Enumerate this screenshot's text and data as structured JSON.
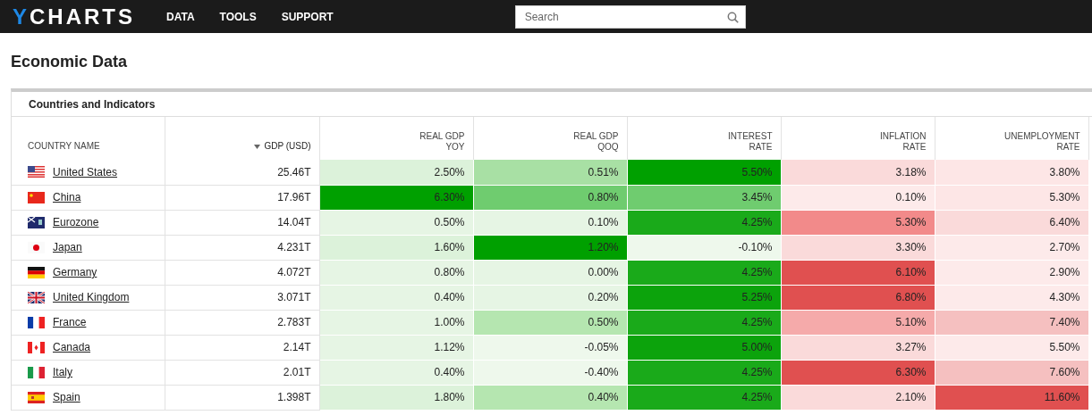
{
  "nav": {
    "logo": "YCHARTS",
    "items": [
      "DATA",
      "TOOLS",
      "SUPPORT"
    ],
    "search": {
      "placeholder": "Search"
    }
  },
  "page_title": "Economic Data",
  "panel": {
    "title": "Countries and Indicators",
    "columns": [
      {
        "label": "COUNTRY NAME",
        "sorted": false
      },
      {
        "label": "GDP (USD)",
        "sorted": true
      },
      {
        "label": "REAL GDP\nYOY",
        "sorted": false
      },
      {
        "label": "REAL GDP\nQOQ",
        "sorted": false
      },
      {
        "label": "INTEREST\nRATE",
        "sorted": false
      },
      {
        "label": "INFLATION\nRATE",
        "sorted": false
      },
      {
        "label": "UNEMPLOYMENT\nRATE",
        "sorted": false
      }
    ],
    "rows": [
      {
        "kind": "us",
        "cells": [
          {
            "text": "United States"
          },
          {
            "text": "25.46T"
          },
          {
            "text": "2.50%",
            "color": "#dcf2da"
          },
          {
            "text": "0.51%",
            "color": "#a8e0a4"
          },
          {
            "text": "5.50%",
            "color": "#00a000"
          },
          {
            "text": "3.18%",
            "color": "#fadada"
          },
          {
            "text": "3.80%",
            "color": "#fde6e6"
          }
        ]
      },
      {
        "kind": "cn",
        "cells": [
          {
            "text": "China"
          },
          {
            "text": "17.96T"
          },
          {
            "text": "6.30%",
            "color": "#00a000"
          },
          {
            "text": "0.80%",
            "color": "#6fcc6f"
          },
          {
            "text": "3.45%",
            "color": "#6fcc6f"
          },
          {
            "text": "0.10%",
            "color": "#fdeaea"
          },
          {
            "text": "5.30%",
            "color": "#fde6e6"
          }
        ]
      },
      {
        "kind": "eu",
        "cells": [
          {
            "text": "Eurozone"
          },
          {
            "text": "14.04T"
          },
          {
            "text": "0.50%",
            "color": "#e6f5e4"
          },
          {
            "text": "0.10%",
            "color": "#e6f5e4"
          },
          {
            "text": "4.25%",
            "color": "#1aaa1a"
          },
          {
            "text": "5.30%",
            "color": "#f28a8a"
          },
          {
            "text": "6.40%",
            "color": "#fadada"
          }
        ]
      },
      {
        "kind": "jp",
        "cells": [
          {
            "text": "Japan"
          },
          {
            "text": "4.231T"
          },
          {
            "text": "1.60%",
            "color": "#dcf2da"
          },
          {
            "text": "1.20%",
            "color": "#00a000"
          },
          {
            "text": "-0.10%",
            "color": "#eef8ec"
          },
          {
            "text": "3.30%",
            "color": "#fadada"
          },
          {
            "text": "2.70%",
            "color": "#fdeaea"
          }
        ]
      },
      {
        "kind": "de",
        "cells": [
          {
            "text": "Germany"
          },
          {
            "text": "4.072T"
          },
          {
            "text": "0.80%",
            "color": "#e6f5e4"
          },
          {
            "text": "0.00%",
            "color": "#e6f5e4"
          },
          {
            "text": "4.25%",
            "color": "#1aaa1a"
          },
          {
            "text": "6.10%",
            "color": "#e05050"
          },
          {
            "text": "2.90%",
            "color": "#fdeaea"
          }
        ]
      },
      {
        "kind": "gb",
        "cells": [
          {
            "text": "United Kingdom"
          },
          {
            "text": "3.071T"
          },
          {
            "text": "0.40%",
            "color": "#e6f5e4"
          },
          {
            "text": "0.20%",
            "color": "#e6f5e4"
          },
          {
            "text": "5.25%",
            "color": "#0ca30c"
          },
          {
            "text": "6.80%",
            "color": "#e05050"
          },
          {
            "text": "4.30%",
            "color": "#fdeaea"
          }
        ]
      },
      {
        "kind": "fr",
        "cells": [
          {
            "text": "France"
          },
          {
            "text": "2.783T"
          },
          {
            "text": "1.00%",
            "color": "#e6f5e4"
          },
          {
            "text": "0.50%",
            "color": "#b5e6b0"
          },
          {
            "text": "4.25%",
            "color": "#1aaa1a"
          },
          {
            "text": "5.10%",
            "color": "#f5aaaa"
          },
          {
            "text": "7.40%",
            "color": "#f5c0c0"
          }
        ]
      },
      {
        "kind": "ca",
        "cells": [
          {
            "text": "Canada"
          },
          {
            "text": "2.14T"
          },
          {
            "text": "1.12%",
            "color": "#e6f5e4"
          },
          {
            "text": "-0.05%",
            "color": "#eef8ec"
          },
          {
            "text": "5.00%",
            "color": "#0ca30c"
          },
          {
            "text": "3.27%",
            "color": "#fadada"
          },
          {
            "text": "5.50%",
            "color": "#fdeaea"
          }
        ]
      },
      {
        "kind": "it",
        "cells": [
          {
            "text": "Italy"
          },
          {
            "text": "2.01T"
          },
          {
            "text": "0.40%",
            "color": "#e6f5e4"
          },
          {
            "text": "-0.40%",
            "color": "#eef8ec"
          },
          {
            "text": "4.25%",
            "color": "#1aaa1a"
          },
          {
            "text": "6.30%",
            "color": "#e05050"
          },
          {
            "text": "7.60%",
            "color": "#f5c0c0"
          }
        ]
      },
      {
        "kind": "es",
        "cells": [
          {
            "text": "Spain"
          },
          {
            "text": "1.398T"
          },
          {
            "text": "1.80%",
            "color": "#dcf2da"
          },
          {
            "text": "0.40%",
            "color": "#b5e6b0"
          },
          {
            "text": "4.25%",
            "color": "#1aaa1a"
          },
          {
            "text": "2.10%",
            "color": "#fadada"
          },
          {
            "text": "11.60%",
            "color": "#e05050"
          }
        ]
      }
    ]
  }
}
